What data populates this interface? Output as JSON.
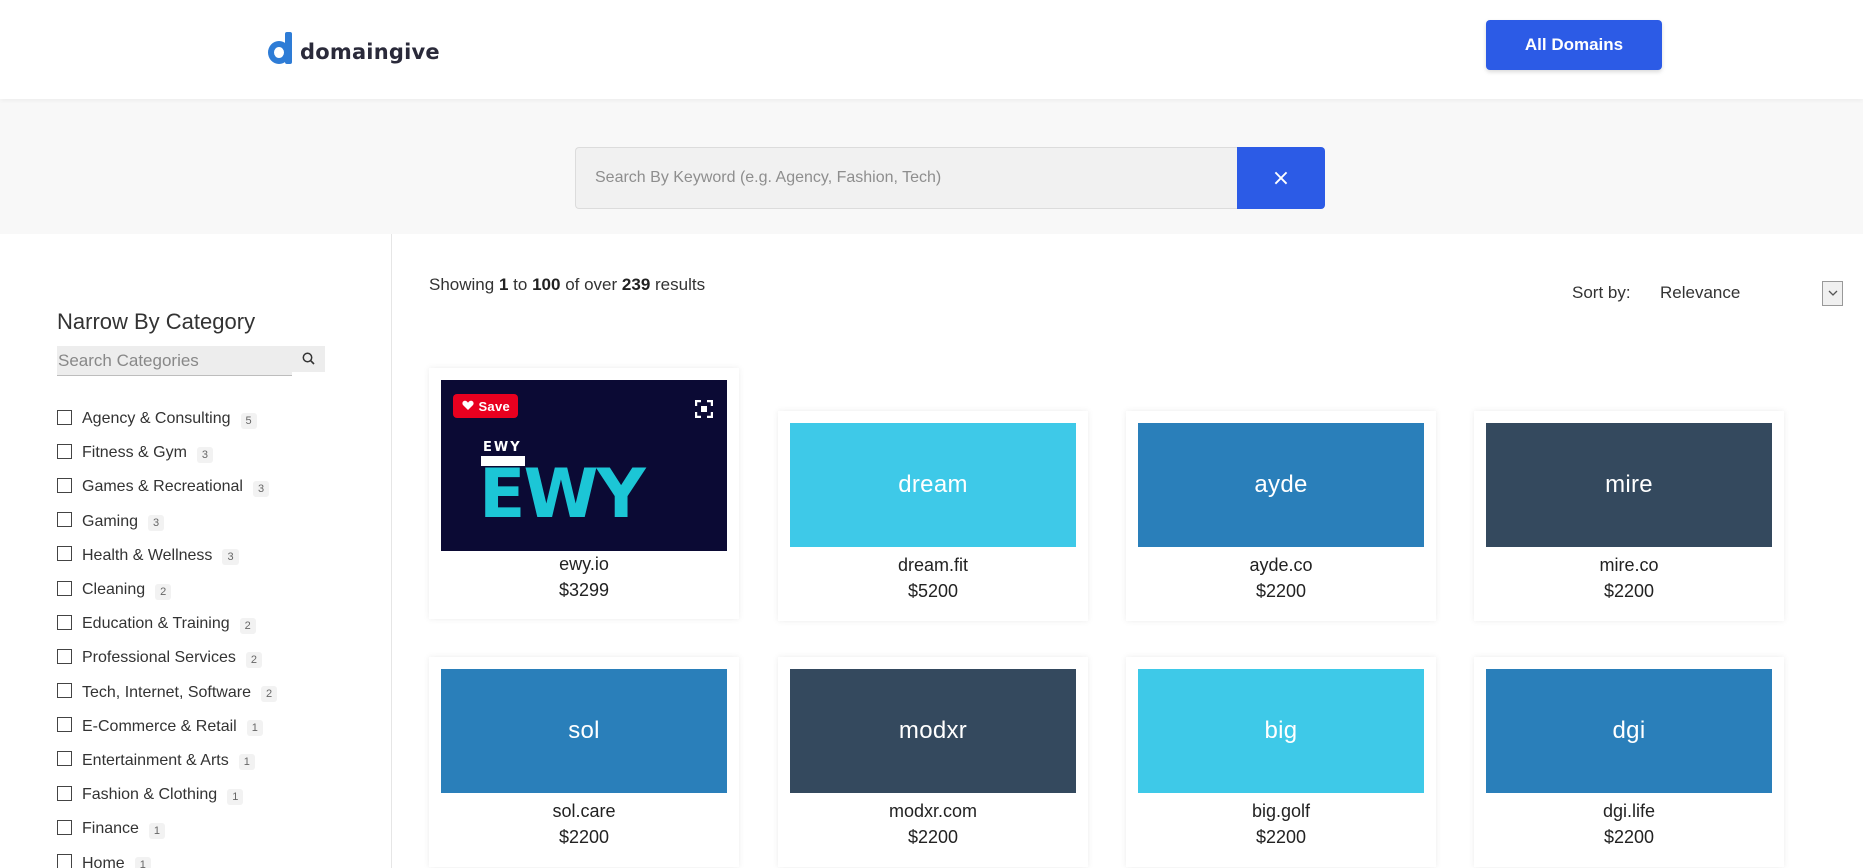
{
  "header": {
    "logo_text": "domaingive",
    "all_domains_label": "All Domains"
  },
  "search": {
    "placeholder": "Search By Keyword (e.g. Agency, Fashion, Tech)",
    "clear_symbol": "×"
  },
  "sidebar": {
    "title": "Narrow By Category",
    "search_placeholder": "Search Categories",
    "categories": [
      {
        "label": "Agency & Consulting",
        "count": "5"
      },
      {
        "label": "Fitness & Gym",
        "count": "3"
      },
      {
        "label": "Games & Recreational",
        "count": "3"
      },
      {
        "label": "Gaming",
        "count": "3"
      },
      {
        "label": "Health & Wellness",
        "count": "3"
      },
      {
        "label": "Cleaning",
        "count": "2"
      },
      {
        "label": "Education & Training",
        "count": "2"
      },
      {
        "label": "Professional Services",
        "count": "2"
      },
      {
        "label": "Tech, Internet, Software",
        "count": "2"
      },
      {
        "label": "E-Commerce & Retail",
        "count": "1"
      },
      {
        "label": "Entertainment & Arts",
        "count": "1"
      },
      {
        "label": "Fashion & Clothing",
        "count": "1"
      },
      {
        "label": "Finance",
        "count": "1"
      },
      {
        "label": "Home",
        "count": "1"
      }
    ]
  },
  "results": {
    "prefix": "Showing",
    "from": "1",
    "to_word": "to",
    "to": "100",
    "of_word": "of over",
    "total": "239",
    "suffix": "results"
  },
  "sort": {
    "label": "Sort by:",
    "value": "Relevance"
  },
  "colors": {
    "accent": "#2c5be6",
    "save_red": "#e8001f",
    "ewy_bg": "#0b0a34",
    "ewy_teal": "#1cc6d6"
  },
  "featured": {
    "save_label": "Save",
    "logo_text": "EWY",
    "logo_small_text": "EWY",
    "name": "ewy.io",
    "price": "$3299"
  },
  "domains": [
    {
      "thumb": "dream",
      "name": "dream.fit",
      "price": "$5200",
      "color": "#3ec9e8"
    },
    {
      "thumb": "ayde",
      "name": "ayde.co",
      "price": "$2200",
      "color": "#2a7fba"
    },
    {
      "thumb": "mire",
      "name": "mire.co",
      "price": "$2200",
      "color": "#34495e"
    },
    {
      "thumb": "sol",
      "name": "sol.care",
      "price": "$2200",
      "color": "#2a7fba"
    },
    {
      "thumb": "modxr",
      "name": "modxr.com",
      "price": "$2200",
      "color": "#34495e"
    },
    {
      "thumb": "big",
      "name": "big.golf",
      "price": "$2200",
      "color": "#3ec9e8"
    },
    {
      "thumb": "dgi",
      "name": "dgi.life",
      "price": "$2200",
      "color": "#2a7fba"
    }
  ]
}
